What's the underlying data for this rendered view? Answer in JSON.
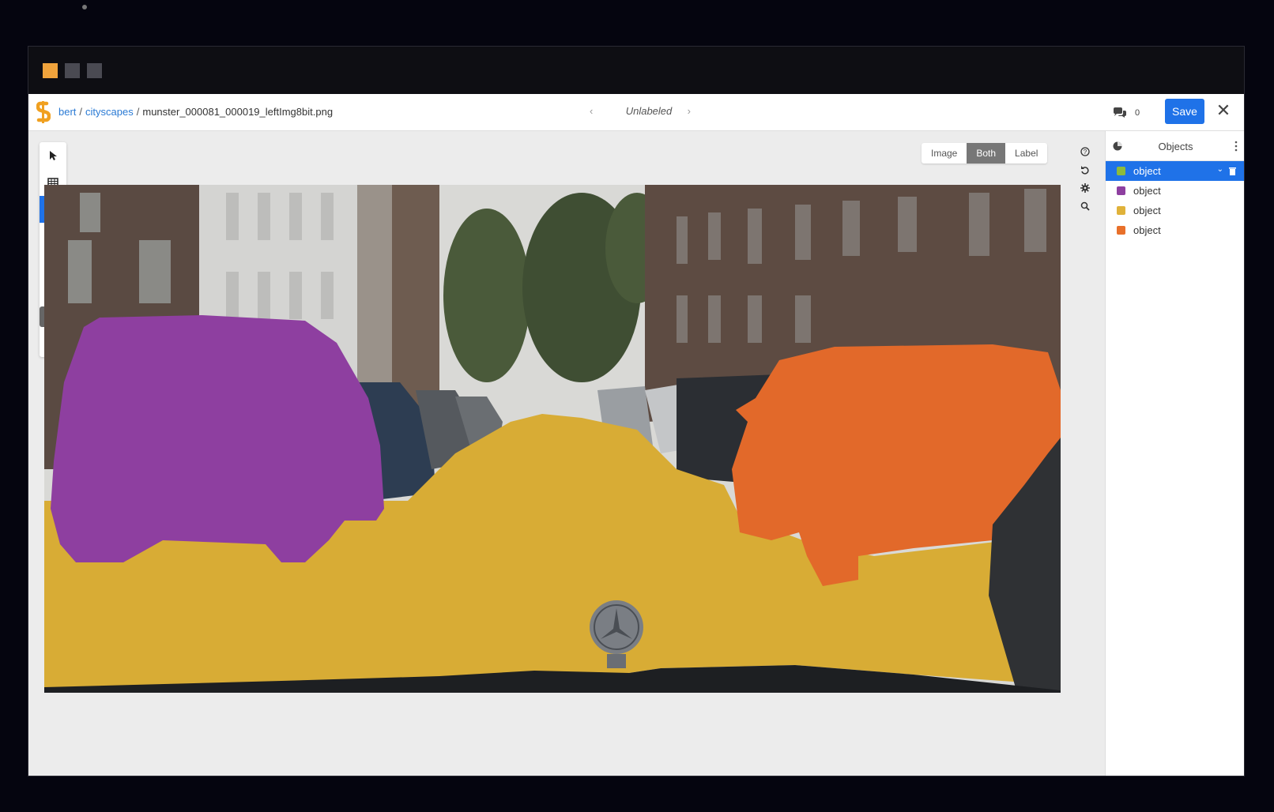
{
  "topbar": {
    "breadcrumb": {
      "user": "bert",
      "dataset": "cityscapes",
      "file": "munster_000081_000019_leftImg8bit.png"
    },
    "status": "Unlabeled",
    "comments_count": "0",
    "save_label": "Save"
  },
  "toolbar": {
    "tools": [
      "pointer-icon",
      "grid-icon",
      "pencil-icon",
      "crop-icon",
      "brush-icon",
      "polygon-icon",
      "lock-icon",
      "eraser-icon"
    ],
    "active_tool": "pencil-icon"
  },
  "view_toggle": {
    "options": [
      "Image",
      "Both",
      "Label"
    ],
    "selected": "Both"
  },
  "right_tools": [
    "help-icon",
    "undo-icon",
    "settings-icon",
    "zoom-icon"
  ],
  "sidebar": {
    "title": "Objects",
    "objects": [
      {
        "label": "object",
        "color": "#8dbb3b",
        "selected": true
      },
      {
        "label": "object",
        "color": "#8e3fa0",
        "selected": false
      },
      {
        "label": "object",
        "color": "#e0b23a",
        "selected": false
      },
      {
        "label": "object",
        "color": "#e8702a",
        "selected": false
      }
    ]
  },
  "colors": {
    "accent": "#1f72e8",
    "purple_mask": "#8e3fa0",
    "road_mask": "#d8ac35",
    "orange_mask": "#e2692a"
  }
}
